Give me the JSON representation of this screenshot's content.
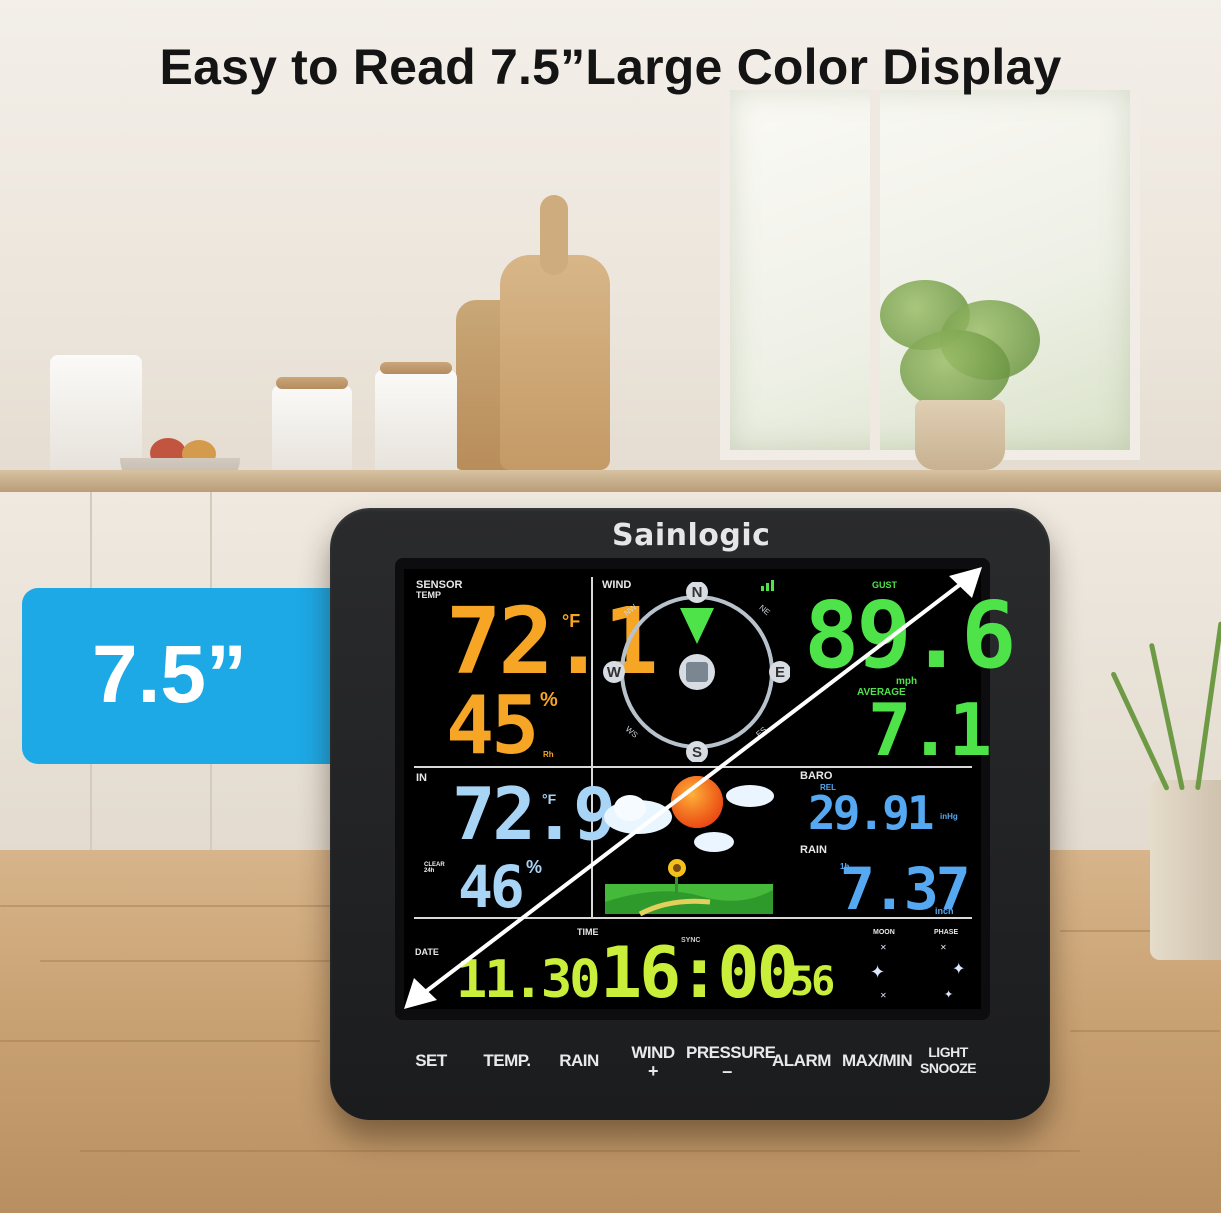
{
  "headline": "Easy to Read 7.5”Large Color Display",
  "size_badge": {
    "text": "7.5”",
    "color": "#1da9e6"
  },
  "device": {
    "brand": "Sainlogic",
    "sensor": {
      "label_line1": "SENSOR",
      "label_line2": "TEMP",
      "temp": "72.1",
      "temp_unit": "°F",
      "humidity": "45",
      "humidity_unit": "%",
      "humidity_sub": "Rh"
    },
    "wind": {
      "label": "WIND",
      "compass": {
        "n": "N",
        "s": "S",
        "e": "E",
        "w": "W",
        "nw": "NW",
        "ne": "NE",
        "ws": "WS",
        "es": "ES"
      },
      "gust_label": "GUST",
      "gust": "89.6",
      "unit": "mph",
      "average_label": "AVERAGE",
      "average": "7.1"
    },
    "indoor": {
      "label": "IN",
      "temp": "72.9",
      "temp_unit": "°F",
      "humidity": "46",
      "humidity_unit": "%",
      "comfort_label": "CLEAR 24h"
    },
    "baro": {
      "label": "BARO",
      "rel_label": "REL",
      "value": "29.91",
      "unit": "inHg"
    },
    "rain": {
      "label": "RAIN",
      "period": "1h",
      "value": "7.37",
      "unit": "inch"
    },
    "time": {
      "date_label": "DATE",
      "date": "11.30",
      "time_label": "TIME",
      "sync_label": "SYNC",
      "time": "16:00",
      "seconds": "56",
      "moon_label": "MOON",
      "phase_label": "PHASE"
    },
    "buttons": [
      {
        "label": "SET",
        "sub": ""
      },
      {
        "label": "TEMP.",
        "sub": ""
      },
      {
        "label": "RAIN",
        "sub": ""
      },
      {
        "label": "WIND",
        "sub": "+"
      },
      {
        "label": "PRESSURE",
        "sub": "–"
      },
      {
        "label": "ALARM",
        "sub": ""
      },
      {
        "label": "MAX/MIN",
        "sub": ""
      },
      {
        "label": "LIGHT",
        "sub": "SNOOZE"
      }
    ],
    "icons": [
      "compass-icon",
      "signal-icon",
      "sun-cloud-icon",
      "sunflower-icon",
      "moon-star-icon",
      "diagonal-arrow-icon"
    ]
  }
}
